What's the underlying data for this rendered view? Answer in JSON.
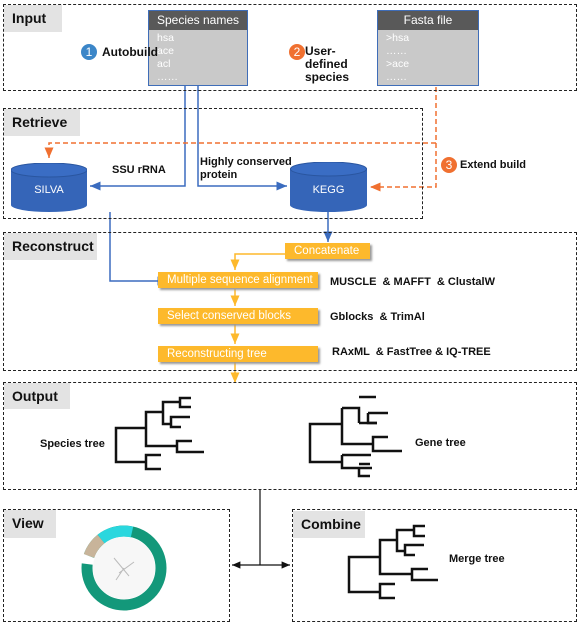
{
  "panels": {
    "input": "Input",
    "retrieve": "Retrieve",
    "reconstruct": "Reconstruct",
    "output": "Output",
    "view": "View",
    "combine": "Combine"
  },
  "species_table": {
    "header": "Species names",
    "rows": [
      "hsa",
      "ace",
      "acl",
      "……"
    ]
  },
  "fasta_table": {
    "header": "Fasta file",
    "rows": [
      ">hsa",
      "……",
      ">ace",
      "……"
    ]
  },
  "modes": [
    {
      "number": "1",
      "label": "Autobuild",
      "color": "#3b86c8"
    },
    {
      "number": "2",
      "label": "User-defined species",
      "color": "#f07030"
    },
    {
      "number": "3",
      "label": "Extend build",
      "color": "#f07030"
    }
  ],
  "databases": {
    "silva": "SILVA",
    "kegg": "KEGG"
  },
  "edge_labels": {
    "ssu": "SSU rRNA",
    "protein": "Highly conserved protein"
  },
  "steps": [
    {
      "label": "Concatenate",
      "tools": ""
    },
    {
      "label": "Multiple sequence alignment",
      "tools": "MUSCLE  & MAFFT  & ClustalW"
    },
    {
      "label": "Select conserved blocks",
      "tools": "Gblocks  & TrimAl"
    },
    {
      "label": "Reconstructing tree",
      "tools": "RAxML  & FastTree & IQ-TREE"
    }
  ],
  "trees": {
    "species": "Species tree",
    "gene": "Gene tree",
    "merge": "Merge tree"
  },
  "colors": {
    "blue": "#3b6cbf",
    "orange": "#f07030",
    "step": "#fdb92c",
    "db": "#3565b8",
    "donut": "#13987a"
  }
}
